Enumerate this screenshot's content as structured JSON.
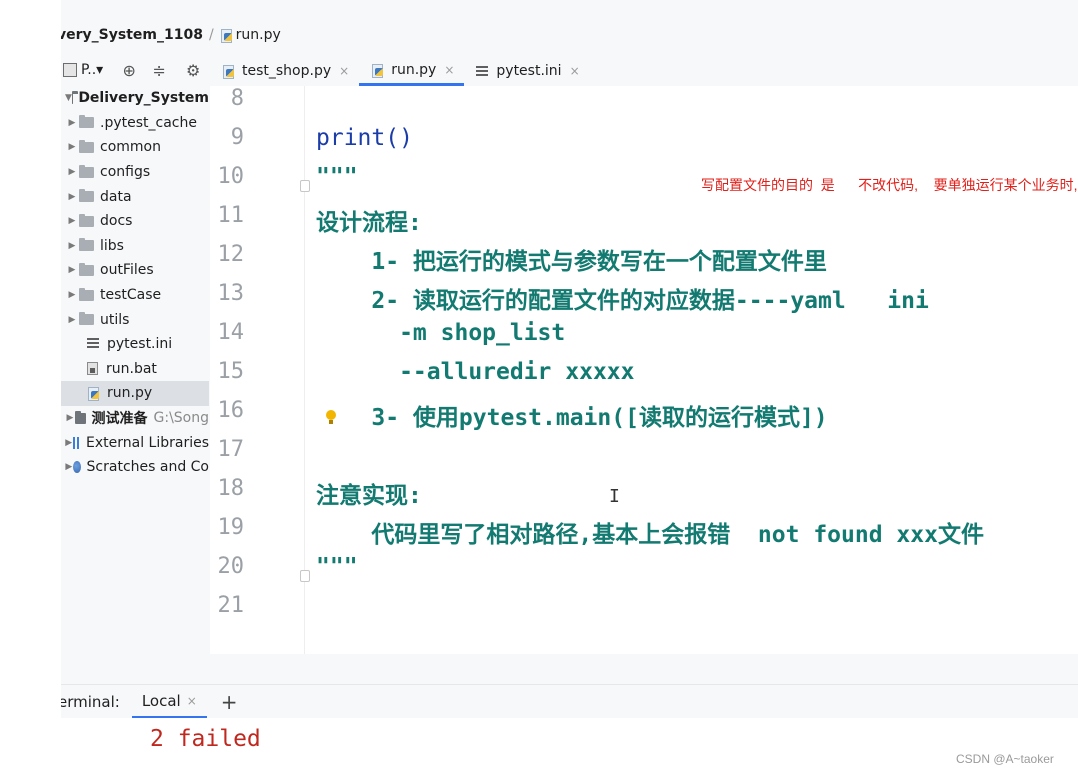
{
  "breadcrumb": {
    "project": "very_System_1108",
    "file": "run.py"
  },
  "project_toolbar": {
    "label": "P..▾",
    "tools": [
      "⊕",
      "≑",
      "⚙"
    ]
  },
  "tree": {
    "root": "Delivery_System",
    "folders": [
      ".pytest_cache",
      "common",
      "configs",
      "data",
      "docs",
      "libs",
      "outFiles",
      "testCase",
      "utils"
    ],
    "files": [
      "pytest.ini",
      "run.bat",
      "run.py"
    ],
    "extra": [
      {
        "label": "测试准备",
        "path": "G:\\Song"
      },
      {
        "label": "External Libraries"
      },
      {
        "label": "Scratches and Co"
      }
    ]
  },
  "tabs": [
    {
      "label": "test_shop.py",
      "close": "×"
    },
    {
      "label": "run.py",
      "close": "×",
      "active": true
    },
    {
      "label": "pytest.ini",
      "close": "×"
    }
  ],
  "editor": {
    "lines": [
      {
        "num": "8",
        "text": ""
      },
      {
        "num": "9",
        "text": "print()"
      },
      {
        "num": "10",
        "text": "\"\"\""
      },
      {
        "num": "11",
        "text": "设计流程:"
      },
      {
        "num": "12",
        "text": "    1- 把运行的模式与参数写在一个配置文件里"
      },
      {
        "num": "13",
        "text": "    2- 读取运行的配置文件的对应数据----yaml   ini"
      },
      {
        "num": "14",
        "text": "      -m shop_list"
      },
      {
        "num": "15",
        "text": "      --alluredir xxxxx"
      },
      {
        "num": "16",
        "text": "    3- 使用pytest.main([读取的运行模式])"
      },
      {
        "num": "17",
        "text": ""
      },
      {
        "num": "18",
        "text": "注意实现:"
      },
      {
        "num": "19",
        "text": "    代码里写了相对路径,基本上会报错  not found xxx文件"
      },
      {
        "num": "20",
        "text": "\"\"\""
      },
      {
        "num": "21",
        "text": ""
      }
    ],
    "annotation": "写配置文件的目的  是      不改代码,    要单独运行某个业务时,去改配置",
    "cursor": "I"
  },
  "terminal": {
    "title": "erminal:",
    "tab": "Local",
    "tab_close": "×",
    "add": "+",
    "output": "2 failed"
  },
  "watermark": "CSDN @A~taoker"
}
